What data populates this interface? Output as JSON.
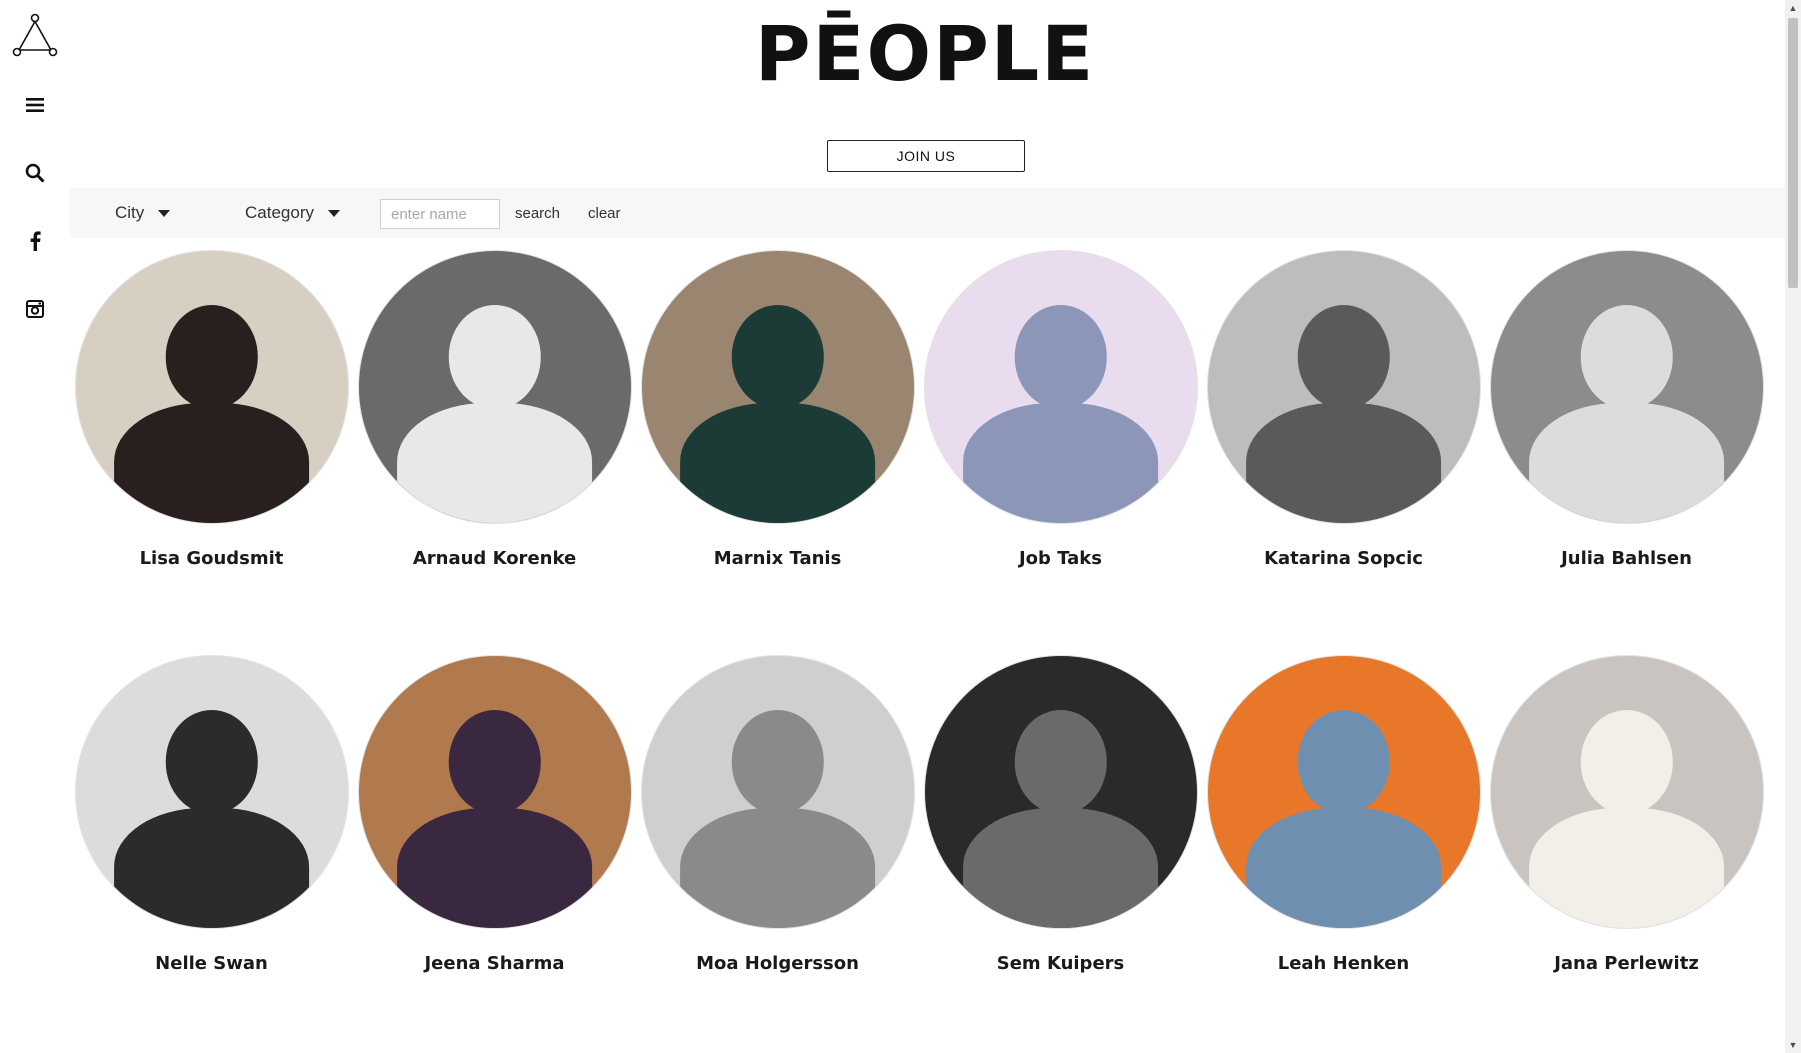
{
  "brand": {
    "title": "PĒOPLE"
  },
  "join_button": {
    "label": "JOIN US"
  },
  "sidebar": {
    "icons": [
      "logo-icon",
      "menu-icon",
      "search-icon",
      "facebook-icon",
      "instagram-icon"
    ]
  },
  "filters": {
    "city_label": "City",
    "category_label": "Category",
    "name_placeholder": "enter name",
    "search_label": "search",
    "clear_label": "clear"
  },
  "people": [
    {
      "name": "Lisa Goudsmit",
      "bg": "#d8cfc3",
      "fg": "#2a1f1f"
    },
    {
      "name": "Arnaud Korenke",
      "bg": "#6a6a6a",
      "fg": "#e8e8e8"
    },
    {
      "name": "Marnix Tanis",
      "bg": "#9a8570",
      "fg": "#1c3a36"
    },
    {
      "name": "Job Taks",
      "bg": "#e9dcef",
      "fg": "#8b96b8"
    },
    {
      "name": "Katarina Sopcic",
      "bg": "#bdbdbd",
      "fg": "#5a5a5a"
    },
    {
      "name": "Julia Bahlsen",
      "bg": "#8c8c8c",
      "fg": "#dcdcdc"
    },
    {
      "name": "Nelle Swan",
      "bg": "#dcdcdc",
      "fg": "#2b2b2b"
    },
    {
      "name": "Jeena Sharma",
      "bg": "#b07a4e",
      "fg": "#3a2840"
    },
    {
      "name": "Moa Holgersson",
      "bg": "#cfcfcf",
      "fg": "#8a8a8a"
    },
    {
      "name": "Sem Kuipers",
      "bg": "#2a2a2a",
      "fg": "#6a6a6a"
    },
    {
      "name": "Leah Henken",
      "bg": "#e8772a",
      "fg": "#6f8fb0"
    },
    {
      "name": "Jana Perlewitz",
      "bg": "#c9c4c0",
      "fg": "#f2efe9"
    }
  ]
}
